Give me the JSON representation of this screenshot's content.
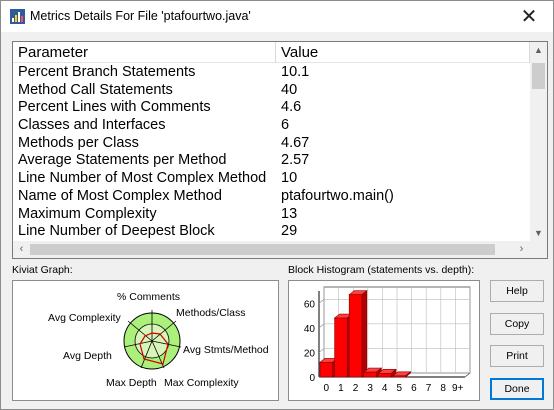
{
  "window": {
    "title": "Metrics Details For File 'ptafourtwo.java'",
    "close_glyph": "✕"
  },
  "table": {
    "headers": {
      "parameter": "Parameter",
      "value": "Value"
    },
    "rows": [
      {
        "parameter": "Percent Branch Statements",
        "value": "10.1"
      },
      {
        "parameter": "Method Call Statements",
        "value": "40"
      },
      {
        "parameter": "Percent Lines with Comments",
        "value": "4.6"
      },
      {
        "parameter": "Classes and Interfaces",
        "value": "6"
      },
      {
        "parameter": "Methods per Class",
        "value": "4.67"
      },
      {
        "parameter": "Average Statements per Method",
        "value": "2.57"
      },
      {
        "parameter": "Line Number of Most Complex Method",
        "value": "10"
      },
      {
        "parameter": "Name of Most Complex Method",
        "value": "ptafourtwo.main()"
      },
      {
        "parameter": "Maximum Complexity",
        "value": "13"
      },
      {
        "parameter": "Line Number of Deepest Block",
        "value": "29"
      }
    ],
    "scroll": {
      "up": "▲",
      "down": "▼",
      "left": "‹",
      "right": "›"
    }
  },
  "kiviat": {
    "label": "Kiviat Graph:",
    "axes": {
      "comments": "% Comments",
      "methods_class": "Methods/Class",
      "avg_stmts": "Avg Stmts/Method",
      "max_complexity": "Max Complexity",
      "max_depth": "Max Depth",
      "avg_depth": "Avg Depth",
      "avg_complexity": "Avg Complexity"
    }
  },
  "histogram": {
    "label": "Block Histogram (statements vs. depth):",
    "y_ticks": [
      "60",
      "40",
      "20",
      "0"
    ],
    "categories": [
      "0",
      "1",
      "2",
      "3",
      "4",
      "5",
      "6",
      "7",
      "8",
      "9+"
    ],
    "values": [
      12,
      48,
      67,
      4,
      3,
      1,
      0,
      0,
      0,
      0
    ],
    "ylim": [
      0,
      70
    ],
    "bar_color": "#ff0000"
  },
  "buttons": {
    "help": "Help",
    "copy": "Copy",
    "print": "Print",
    "done": "Done"
  }
}
